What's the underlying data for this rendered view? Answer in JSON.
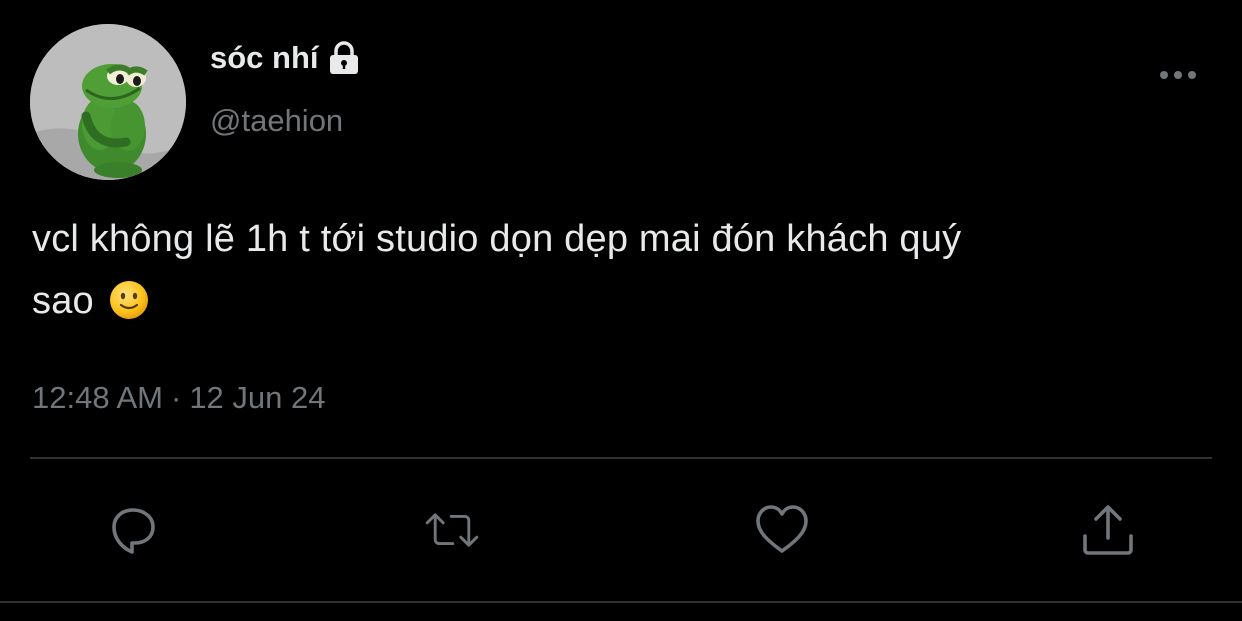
{
  "user": {
    "display_name": "sóc nhí",
    "handle": "@taehion",
    "avatar": "kermit-frog-avatar",
    "protected_icon": "lock-icon"
  },
  "tweet": {
    "text_line1": "vcl không lẽ 1h t tới studio dọn dẹp mai đón khách quý",
    "text_line2": "sao",
    "emoji": "slightly-smiling-face-emoji",
    "time": "12:48 AM",
    "separator": "·",
    "date": "12 Jun 24"
  },
  "actions": {
    "reply": "reply-icon",
    "retweet": "retweet-icon",
    "like": "like-icon",
    "share": "share-icon",
    "more": "more-icon"
  },
  "colors": {
    "background": "#000000",
    "text_primary": "#e7e9ea",
    "text_secondary": "#71767b",
    "icon": "#71767b",
    "divider": "#2f3336"
  }
}
